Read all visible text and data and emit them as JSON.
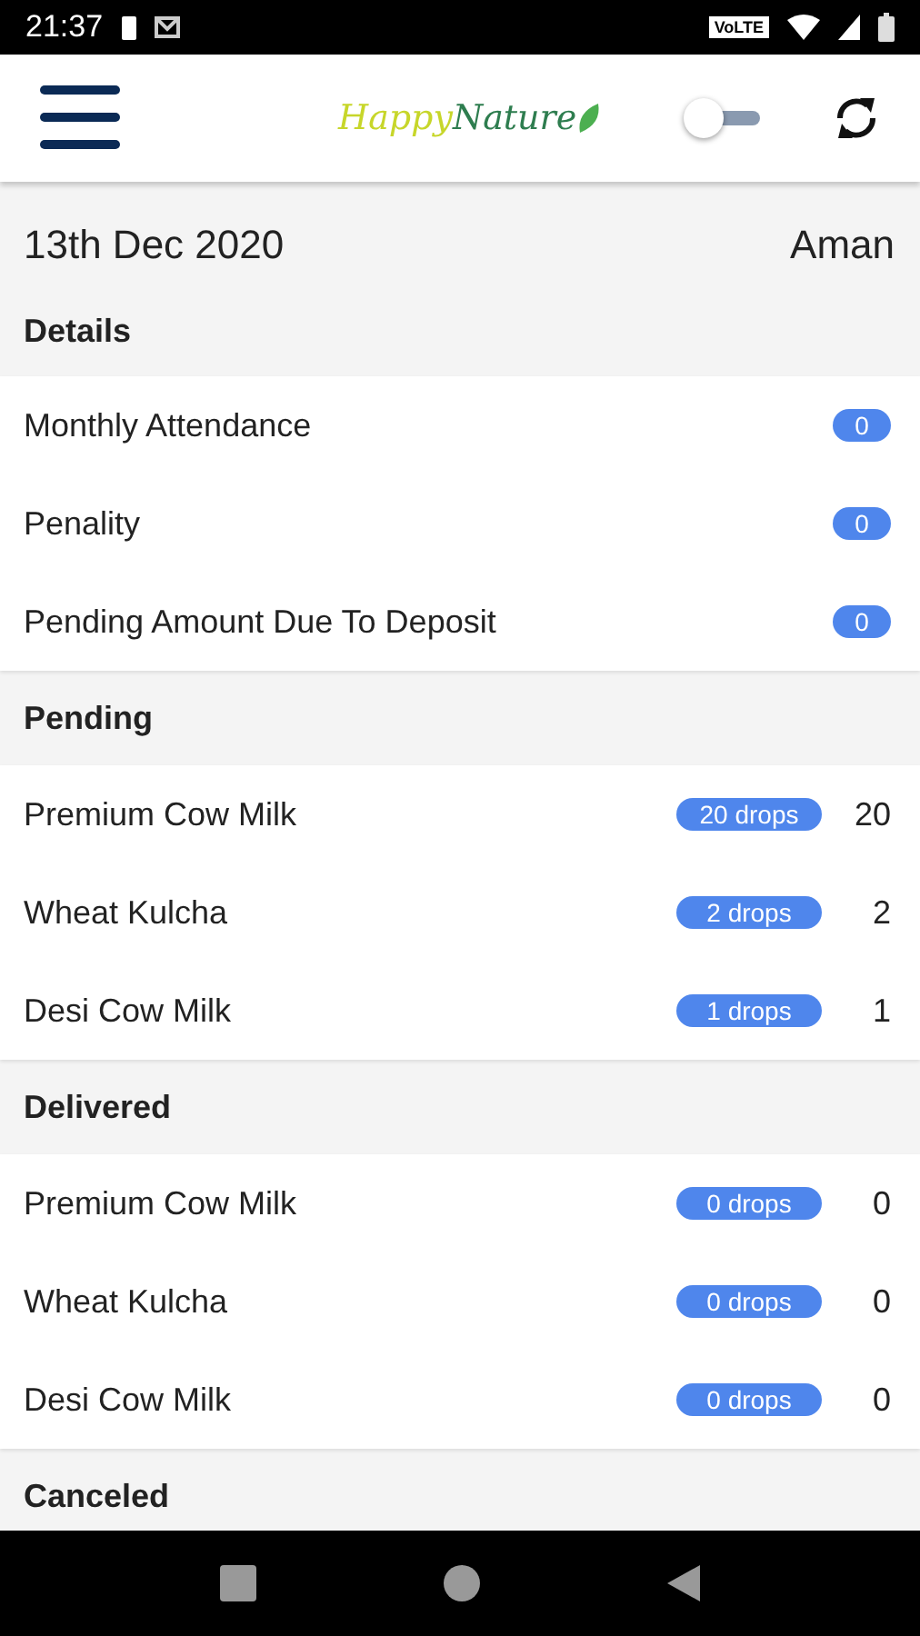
{
  "status_bar": {
    "time": "21:37",
    "network_label": "VoLTE"
  },
  "header": {
    "logo": {
      "word_1": "Happy",
      "word_2": "Nature"
    },
    "dark_mode_toggle": {
      "on": false
    }
  },
  "date": "13th Dec 2020",
  "user": "Aman",
  "sections": [
    {
      "title": "Details",
      "rows": [
        {
          "label": "Monthly Attendance",
          "badge": "0"
        },
        {
          "label": "Penality",
          "badge": "0"
        },
        {
          "label": "Pending Amount Due To Deposit",
          "badge": "0"
        }
      ]
    },
    {
      "title": "Pending",
      "rows": [
        {
          "label": "Premium Cow Milk",
          "badge": "20 drops",
          "count": "20"
        },
        {
          "label": "Wheat Kulcha",
          "badge": "2 drops",
          "count": "2"
        },
        {
          "label": "Desi Cow Milk",
          "badge": "1 drops",
          "count": "1"
        }
      ]
    },
    {
      "title": "Delivered",
      "rows": [
        {
          "label": "Premium Cow Milk",
          "badge": "0 drops",
          "count": "0"
        },
        {
          "label": "Wheat Kulcha",
          "badge": "0 drops",
          "count": "0"
        },
        {
          "label": "Desi Cow Milk",
          "badge": "0 drops",
          "count": "0"
        }
      ]
    },
    {
      "title": "Canceled"
    }
  ]
}
